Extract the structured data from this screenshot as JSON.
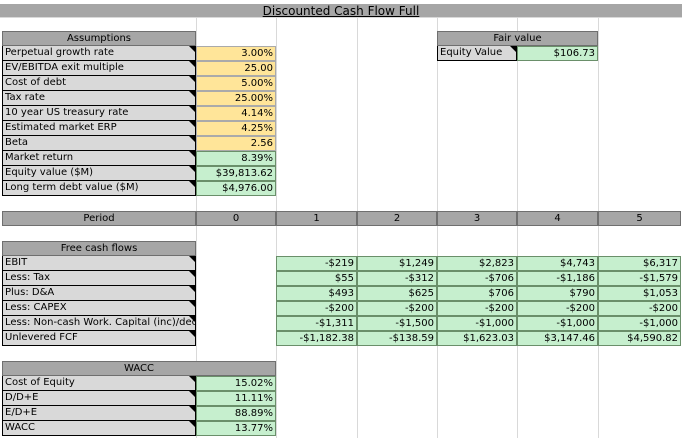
{
  "title": "Discounted Cash Flow Full",
  "assumptions": {
    "header": "Assumptions",
    "rows": [
      {
        "label": "Perpetual growth rate",
        "value": "3.00%"
      },
      {
        "label": "EV/EBITDA exit multiple",
        "value": "25.00"
      },
      {
        "label": "Cost of debt",
        "value": "5.00%"
      },
      {
        "label": "Tax rate",
        "value": "25.00%"
      },
      {
        "label": "10 year US treasury rate",
        "value": "4.14%"
      },
      {
        "label": "Estimated market ERP",
        "value": "4.25%"
      },
      {
        "label": "Beta",
        "value": "2.56"
      },
      {
        "label": "Market return",
        "value": "8.39%"
      },
      {
        "label": "Equity value ($M)",
        "value": "$39,813.62"
      },
      {
        "label": "Long term debt value ($M)",
        "value": "$4,976.00"
      }
    ]
  },
  "fair_value": {
    "header": "Fair value",
    "label": "Equity Value",
    "value": "$106.73"
  },
  "period": {
    "label": "Period",
    "values": [
      "0",
      "1",
      "2",
      "3",
      "4",
      "5"
    ]
  },
  "fcf": {
    "header": "Free cash flows",
    "rows": [
      {
        "label": "EBIT",
        "values": [
          "-$219",
          "$1,249",
          "$2,823",
          "$4,743",
          "$6,317"
        ]
      },
      {
        "label": "Less: Tax",
        "values": [
          "$55",
          "-$312",
          "-$706",
          "-$1,186",
          "-$1,579"
        ]
      },
      {
        "label": "Plus: D&A",
        "values": [
          "$493",
          "$625",
          "$706",
          "$790",
          "$1,053"
        ]
      },
      {
        "label": "Less: CAPEX",
        "values": [
          "-$200",
          "-$200",
          "-$200",
          "-$200",
          "-$200"
        ]
      },
      {
        "label": "Less: Non-cash Work. Capital (inc)/dec",
        "values": [
          "-$1,311",
          "-$1,500",
          "-$1,000",
          "-$1,000",
          "-$1,000"
        ]
      },
      {
        "label": "Unlevered FCF",
        "values": [
          "-$1,182.38",
          "-$138.59",
          "$1,623.03",
          "$3,147.46",
          "$4,590.82"
        ]
      }
    ]
  },
  "wacc": {
    "header": "WACC",
    "rows": [
      {
        "label": "Cost of Equity",
        "value": "15.02%"
      },
      {
        "label": "D/D+E",
        "value": "11.11%"
      },
      {
        "label": "E/D+E",
        "value": "88.89%"
      },
      {
        "label": "WACC",
        "value": "13.77%"
      }
    ]
  }
}
